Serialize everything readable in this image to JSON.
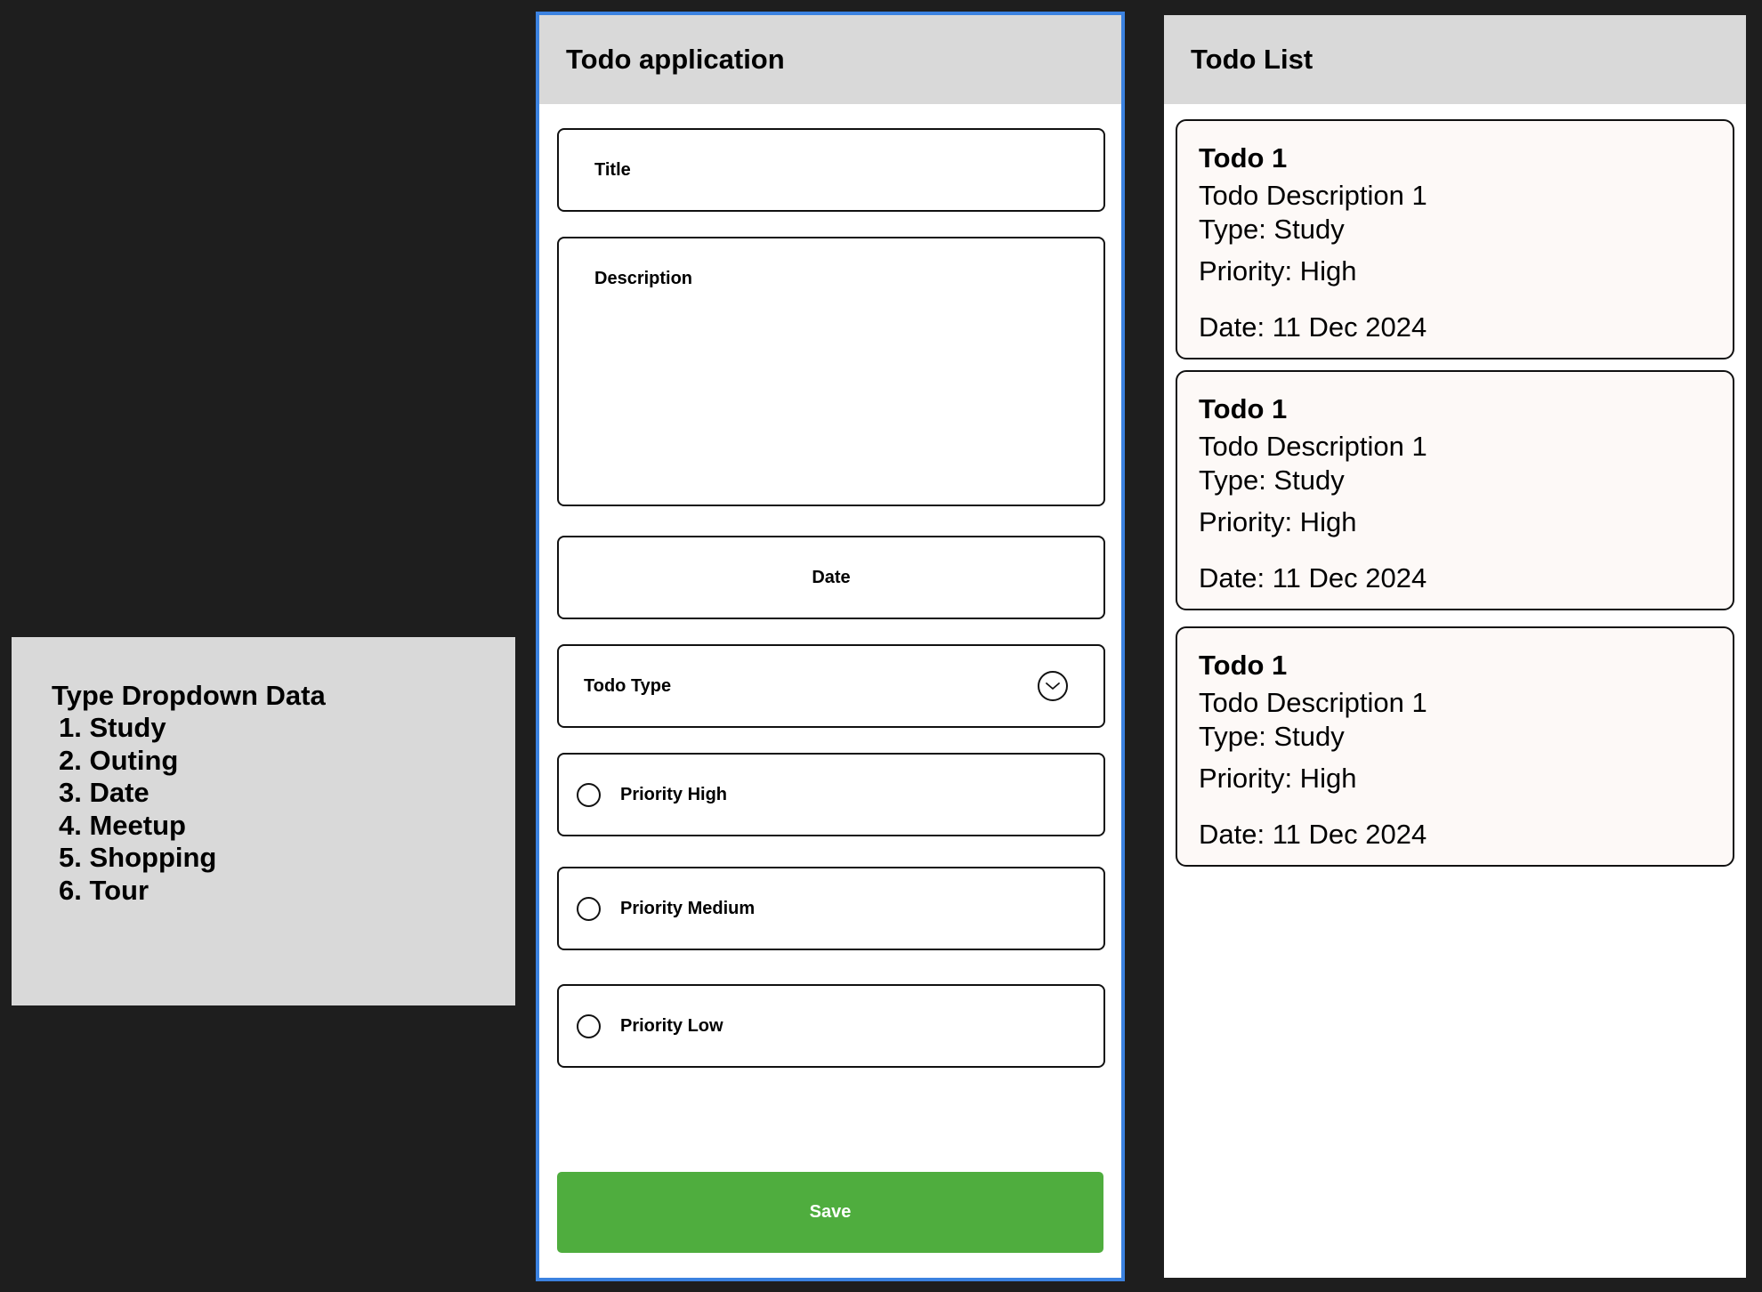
{
  "note": {
    "title": "Type Dropdown Data",
    "items": [
      "1. Study",
      "2. Outing",
      "3. Date",
      "4. Meetup",
      "5. Shopping",
      "6. Tour"
    ]
  },
  "form": {
    "header": "Todo application",
    "title_placeholder": "Title",
    "description_placeholder": "Description",
    "date_placeholder": "Date",
    "todo_type_label": "Todo Type",
    "priorities": [
      "Priority High",
      "Priority Medium",
      "Priority Low"
    ],
    "save_label": "Save",
    "save_color": "#4fad3e",
    "accent_border_color": "#3b82e0",
    "chevron_icon": "chevron-down-circle-icon"
  },
  "list": {
    "header": "Todo List",
    "todos": [
      {
        "title": "Todo 1",
        "description": "Todo Description 1",
        "type": "Type: Study",
        "priority": "Priority: High",
        "date": "Date: 11 Dec 2024"
      },
      {
        "title": "Todo 1",
        "description": "Todo Description 1",
        "type": "Type: Study",
        "priority": "Priority: High",
        "date": "Date: 11 Dec 2024"
      },
      {
        "title": "Todo 1",
        "description": "Todo Description 1",
        "type": "Type: Study",
        "priority": "Priority: High",
        "date": "Date: 11 Dec 2024"
      }
    ]
  }
}
